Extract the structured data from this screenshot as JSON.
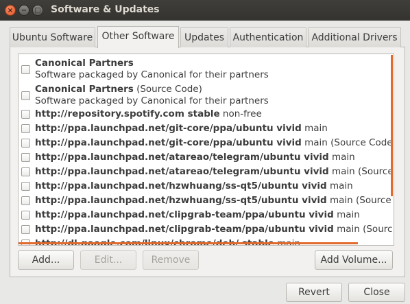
{
  "window": {
    "title": "Software & Updates",
    "close_glyph": "×",
    "minimize_glyph": "−",
    "maximize_glyph": "□"
  },
  "tabs": [
    {
      "label": "Ubuntu Software",
      "active": false
    },
    {
      "label": "Other Software",
      "active": true
    },
    {
      "label": "Updates",
      "active": false
    },
    {
      "label": "Authentication",
      "active": false
    },
    {
      "label": "Additional Drivers",
      "active": false
    }
  ],
  "sources": [
    {
      "bold": "Canonical Partners",
      "normal": "",
      "subtitle": "Software packaged by Canonical for their partners",
      "checked": false
    },
    {
      "bold": "Canonical Partners",
      "normal": " (Source Code)",
      "subtitle": "Software packaged by Canonical for their partners",
      "checked": false
    },
    {
      "bold": "http://repository.spotify.com stable",
      "normal": " non-free",
      "subtitle": "",
      "checked": false
    },
    {
      "bold": "http://ppa.launchpad.net/git-core/ppa/ubuntu vivid",
      "normal": " main",
      "subtitle": "",
      "checked": false
    },
    {
      "bold": "http://ppa.launchpad.net/git-core/ppa/ubuntu vivid",
      "normal": " main (Source Code)",
      "subtitle": "",
      "checked": false
    },
    {
      "bold": "http://ppa.launchpad.net/atareao/telegram/ubuntu vivid",
      "normal": " main",
      "subtitle": "",
      "checked": false
    },
    {
      "bold": "http://ppa.launchpad.net/atareao/telegram/ubuntu vivid",
      "normal": " main (Source Co",
      "subtitle": "",
      "checked": false
    },
    {
      "bold": "http://ppa.launchpad.net/hzwhuang/ss-qt5/ubuntu vivid",
      "normal": " main",
      "subtitle": "",
      "checked": false
    },
    {
      "bold": "http://ppa.launchpad.net/hzwhuang/ss-qt5/ubuntu vivid",
      "normal": " main (Source Cod",
      "subtitle": "",
      "checked": false
    },
    {
      "bold": "http://ppa.launchpad.net/clipgrab-team/ppa/ubuntu vivid",
      "normal": " main",
      "subtitle": "",
      "checked": false
    },
    {
      "bold": "http://ppa.launchpad.net/clipgrab-team/ppa/ubuntu vivid",
      "normal": " main (Source Co",
      "subtitle": "",
      "checked": false
    },
    {
      "bold": "http://dl.google.com/linux/chrome/deb/ stable",
      "normal": " main",
      "subtitle": "",
      "checked": false
    }
  ],
  "list_buttons": {
    "add": "Add...",
    "edit": "Edit...",
    "remove": "Remove",
    "add_volume": "Add Volume..."
  },
  "dialog_buttons": {
    "revert": "Revert",
    "close": "Close"
  },
  "colors": {
    "accent_scrollbar": "#e26a2c",
    "titlebar": "#3c3b37"
  }
}
